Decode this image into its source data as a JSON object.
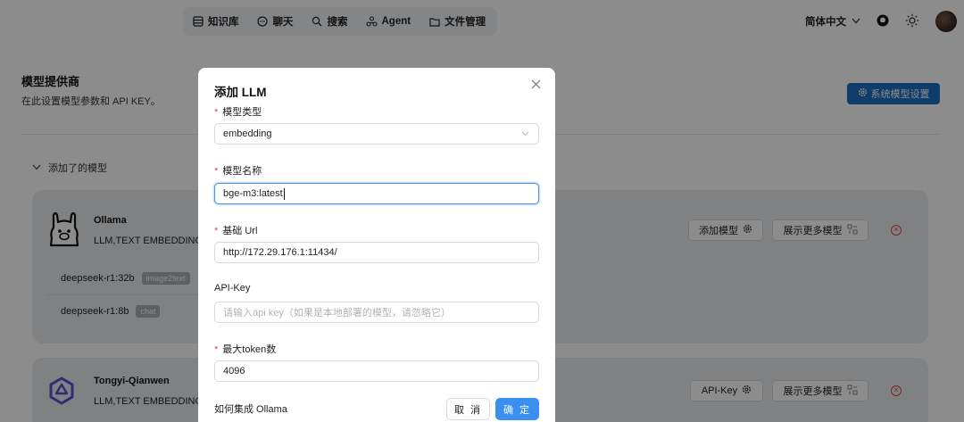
{
  "nav": {
    "items": [
      {
        "label": "知识库",
        "icon": "knowledge-icon"
      },
      {
        "label": "聊天",
        "icon": "chat-icon"
      },
      {
        "label": "搜索",
        "icon": "search-icon"
      },
      {
        "label": "Agent",
        "icon": "agent-icon"
      },
      {
        "label": "文件管理",
        "icon": "folder-icon"
      }
    ],
    "language": "简体中文"
  },
  "page": {
    "title": "模型提供商",
    "subtitle": "在此设置模型参数和 API KEY。",
    "system_settings_button": "系统模型设置",
    "added_models_label": "添加了的模型"
  },
  "providers": [
    {
      "name": "Ollama",
      "tags": "LLM,TEXT EMBEDDING",
      "buttons": [
        "添加模型",
        "展示更多模型"
      ],
      "models": [
        {
          "name": "deepseek-r1:32b",
          "chip": "image2text"
        },
        {
          "name": "deepseek-r1:8b",
          "chip": "chat"
        }
      ]
    },
    {
      "name": "Tongyi-Qianwen",
      "tags": "LLM,TEXT EMBEDDING",
      "buttons": [
        "API-Key",
        "展示更多模型"
      ]
    }
  ],
  "modal": {
    "title": "添加 LLM",
    "fields": {
      "model_type": {
        "label": "模型类型",
        "value": "embedding",
        "required": true
      },
      "model_name": {
        "label": "模型名称",
        "value": "bge-m3:latest",
        "required": true
      },
      "base_url": {
        "label": "基础 Url",
        "value": "http://172.29.176.1:11434/",
        "required": true
      },
      "api_key": {
        "label": "API-Key",
        "placeholder": "请输入api key（如果是本地部署的模型，请忽略它）",
        "required": false
      },
      "max_tokens": {
        "label": "最大token数",
        "value": "4096",
        "required": true
      }
    },
    "help_link": "如何集成 Ollama",
    "cancel_label": "取 消",
    "ok_label": "确 定"
  },
  "colors": {
    "primary": "#1a6fc4",
    "ok_button": "#3b8ff0",
    "danger": "#e0474c",
    "card_bg": "#e9ebee"
  }
}
